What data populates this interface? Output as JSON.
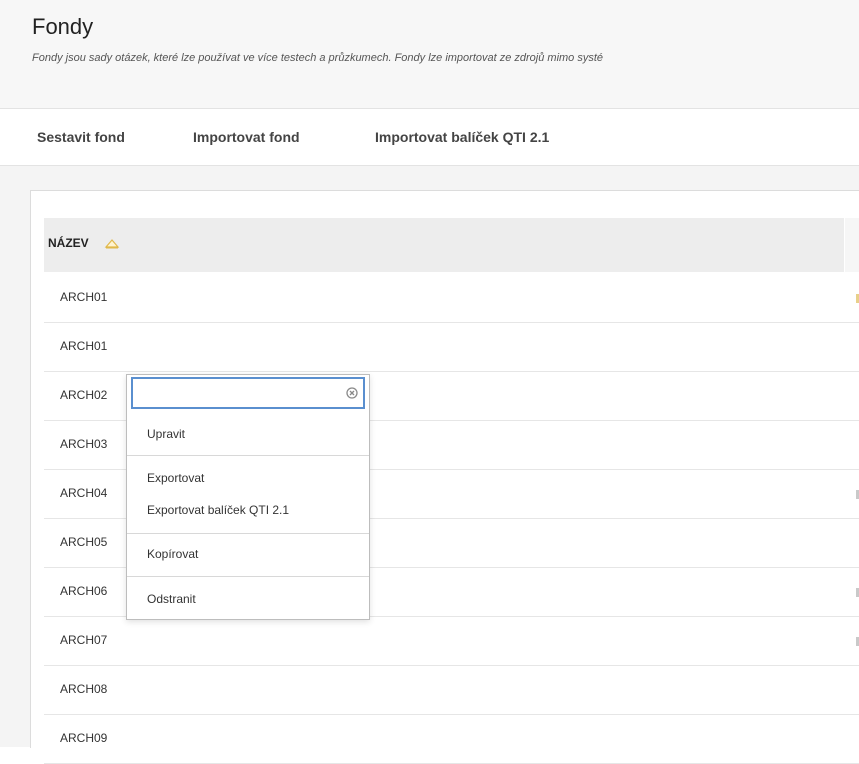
{
  "page": {
    "title": "Fondy",
    "description": "Fondy jsou sady otázek, které lze používat ve více testech a průzkumech. Fondy lze importovat ze zdrojů mimo systé"
  },
  "toolbar": {
    "build_label": "Sestavit fond",
    "import_label": "Importovat fond",
    "import_qti_label": "Importovat balíček QTI 2.1"
  },
  "table": {
    "header_name": "NÁZEV",
    "sort_icon": "sort-ascending-icon",
    "rows": [
      "ARCH01",
      "ARCH01",
      "ARCH02",
      "ARCH03",
      "ARCH04",
      "ARCH05",
      "ARCH06",
      "ARCH07",
      "ARCH08",
      "ARCH09"
    ]
  },
  "context_menu": {
    "search_value": "",
    "clear_icon": "clear-icon",
    "items": [
      "Upravit",
      "Exportovat",
      "Exportovat balíček QTI 2.1",
      "Kopírovat",
      "Odstranit"
    ]
  },
  "colors": {
    "focus_border": "#5a8fcf",
    "sort_icon": "#e0b84a",
    "header_bg": "#ededed"
  }
}
